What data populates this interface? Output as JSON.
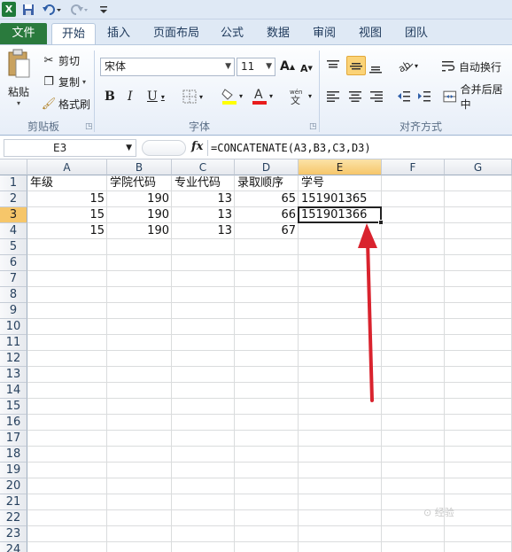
{
  "ribbon_tabs": [
    "文件",
    "开始",
    "插入",
    "页面布局",
    "公式",
    "数据",
    "审阅",
    "视图",
    "团队"
  ],
  "clipboard": {
    "paste": "粘贴",
    "cut": "剪切",
    "copy": "复制",
    "format_painter": "格式刷",
    "group_label": "剪贴板"
  },
  "font": {
    "name": "宋体",
    "size": "11",
    "group_label": "字体",
    "bold": "B",
    "italic": "I",
    "underline": "U",
    "grow": "A",
    "shrink": "A"
  },
  "alignment": {
    "wrap_text": "自动换行",
    "merge_center": "合并后居中",
    "group_label": "对齐方式"
  },
  "formula_bar": {
    "name_box": "E3",
    "fx": "fx",
    "formula": "=CONCATENATE(A3,B3,C3,D3)"
  },
  "grid": {
    "columns": [
      "A",
      "B",
      "C",
      "D",
      "E",
      "F",
      "G"
    ],
    "rows": [
      "1",
      "2",
      "3",
      "4",
      "5",
      "6",
      "7",
      "8",
      "9",
      "10",
      "11",
      "12",
      "13",
      "14",
      "15",
      "16",
      "17",
      "18",
      "19",
      "20",
      "21",
      "22",
      "23",
      "24"
    ],
    "headers": [
      "年级",
      "学院代码",
      "专业代码",
      "录取顺序",
      "学号"
    ],
    "data": [
      [
        "15",
        "190",
        "13",
        "65",
        "151901365"
      ],
      [
        "15",
        "190",
        "13",
        "66",
        "151901366"
      ],
      [
        "15",
        "190",
        "13",
        "67",
        ""
      ]
    ],
    "selected_cell": "E3"
  },
  "colors": {
    "file_tab": "#2a7a3d",
    "selection_header": "#f6c66a",
    "annotation_arrow": "#d9232e"
  }
}
